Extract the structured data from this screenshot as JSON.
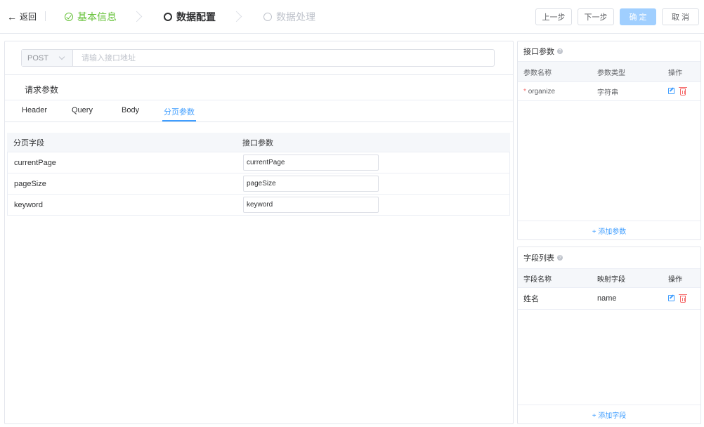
{
  "header": {
    "back_label": "返回",
    "steps": [
      {
        "label": "基本信息",
        "state": "done"
      },
      {
        "label": "数据配置",
        "state": "active"
      },
      {
        "label": "数据处理",
        "state": "pending"
      }
    ],
    "buttons": {
      "prev": "上一步",
      "next": "下一步",
      "confirm": "确 定",
      "cancel": "取 消"
    }
  },
  "request": {
    "method": "POST",
    "url_placeholder": "请输入接口地址",
    "url_value": "",
    "section_title": "请求参数",
    "tabs": [
      "Header",
      "Query",
      "Body",
      "分页参数"
    ],
    "active_tab": "分页参数",
    "paging_table": {
      "columns": [
        "分页字段",
        "接口参数"
      ],
      "rows": [
        {
          "field": "currentPage",
          "param": "currentPage"
        },
        {
          "field": "pageSize",
          "param": "pageSize"
        },
        {
          "field": "keyword",
          "param": "keyword"
        }
      ]
    }
  },
  "api_params": {
    "title": "接口参数",
    "columns": [
      "参数名称",
      "参数类型",
      "操作"
    ],
    "rows": [
      {
        "required_mark": "*",
        "name": "organize",
        "type": "字符串"
      }
    ],
    "add_label": "+ 添加参数"
  },
  "fields": {
    "title": "字段列表",
    "columns": [
      "字段名称",
      "映射字段",
      "操作"
    ],
    "rows": [
      {
        "name": "姓名",
        "mapping": "name"
      }
    ],
    "add_label": "+ 添加字段"
  },
  "colors": {
    "primary": "#409eff",
    "success": "#67c23a",
    "danger": "#f56c6c",
    "disabled_primary": "#a0cfff"
  }
}
